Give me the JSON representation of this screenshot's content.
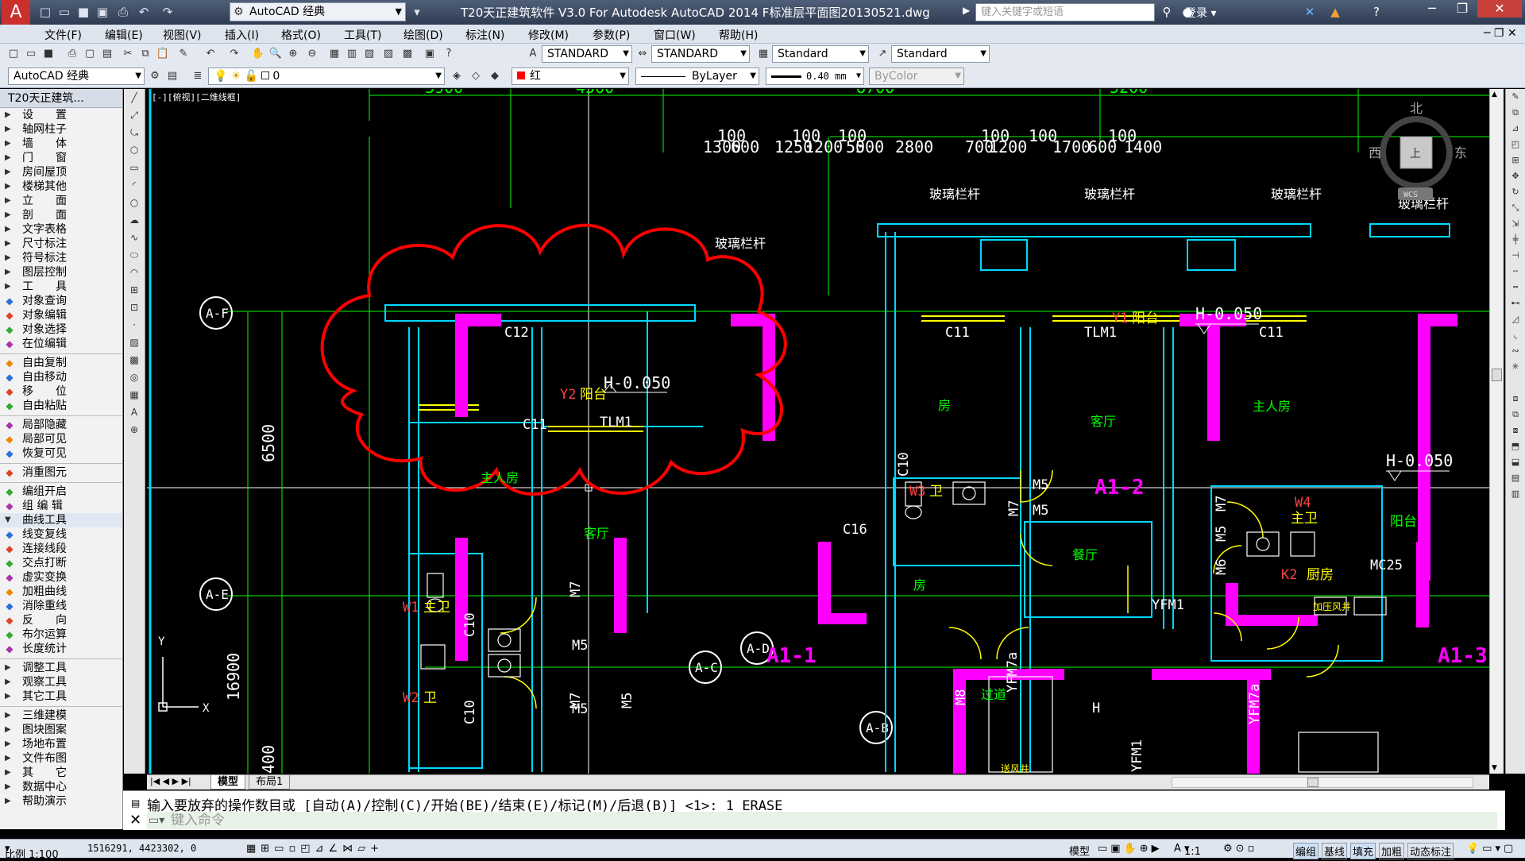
{
  "app": {
    "workspace": "AutoCAD 经典",
    "title": "T20天正建筑软件 V3.0 For Autodesk AutoCAD 2014    F标准层平面图20130521.dwg",
    "search_placeholder": "键入关键字或短语",
    "login": "登录"
  },
  "menu": [
    "文件(F)",
    "编辑(E)",
    "视图(V)",
    "插入(I)",
    "格式(O)",
    "工具(T)",
    "绘图(D)",
    "标注(N)",
    "修改(M)",
    "参数(P)",
    "窗口(W)",
    "帮助(H)"
  ],
  "toolbar": {
    "text_style": "STANDARD",
    "dim_style": "STANDARD",
    "table_style": "Standard",
    "mleader_style": "Standard",
    "workspace2": "AutoCAD 经典",
    "layer": "0",
    "color": "红",
    "linetype": "ByLayer",
    "lineweight": "0.40 mm",
    "plotstyle": "ByColor"
  },
  "left_panel": {
    "title": "T20天正建筑...",
    "items": [
      "设　　置",
      "轴网柱子",
      "墙　　体",
      "门　　窗",
      "房间屋顶",
      "楼梯其他",
      "立　　面",
      "剖　　面",
      "文字表格",
      "尺寸标注",
      "符号标注",
      "图层控制",
      "工　　具"
    ],
    "tools": [
      "对象查询",
      "对象编辑",
      "对象选择",
      "在位编辑",
      "自由复制",
      "自由移动",
      "移　　位",
      "自由粘贴",
      "局部隐藏",
      "局部可见",
      "恢复可见",
      "消重图元",
      "编组开启",
      "组 编 辑"
    ],
    "curve_header": "曲线工具",
    "curve_items": [
      "线变复线",
      "连接线段",
      "交点打断",
      "虚实变换",
      "加粗曲线",
      "消除重线",
      "反　　向",
      "布尔运算",
      "长度统计"
    ],
    "bottom_items": [
      "调整工具",
      "观察工具",
      "其它工具",
      "三维建模",
      "图块图案",
      "场地布置",
      "文件布图",
      "其　　它",
      "数据中心",
      "帮助演示"
    ]
  },
  "canvas": {
    "viewport_label": "[-][俯视][二维线框]",
    "dims_top": [
      "3900",
      "4500",
      "8700",
      "5200"
    ],
    "dims_second": [
      "1300",
      "100",
      "600",
      "1250",
      "100",
      "1200",
      "100",
      "50",
      "500",
      "2800",
      "700",
      "100",
      "1200",
      "100",
      "1700",
      "600",
      "100",
      "1400"
    ],
    "railing": "玻璃栏杆",
    "elev1": "H-0.050",
    "axis_labels": [
      "A-F",
      "A-E",
      "A-D",
      "A-C",
      "A-B"
    ],
    "windows": [
      "C12",
      "C11",
      "C11",
      "C11",
      "C10",
      "C16",
      "C10",
      "C10",
      "MC25"
    ],
    "doors": [
      "M5",
      "M5",
      "M7",
      "M5",
      "M7",
      "M8",
      "M5",
      "M6",
      "M7",
      "M5",
      "YFM1",
      "YFM7a",
      "YFM7a",
      "YFM1"
    ],
    "rooms": [
      "房",
      "客厅",
      "主人房",
      "主人房",
      "客厅",
      "房",
      "餐厅",
      "厨房",
      "过道",
      "阳台",
      "卫",
      "主卫"
    ],
    "tags_red": [
      "Y1",
      "Y2",
      "W3",
      "W4",
      "W1",
      "W2",
      "K2"
    ],
    "tag_texts": [
      "阳台",
      "阳台",
      "卫",
      "主卫",
      "主卫",
      "卫",
      "厨房"
    ],
    "units": [
      "A1-1",
      "A1-2",
      "A1-3"
    ],
    "dim_left": [
      "6500",
      "16900",
      "400"
    ],
    "tlm": "TLM1",
    "compass": {
      "n": "北",
      "e": "东",
      "w": "西",
      "center": "上",
      "wcs": "WCS"
    },
    "misc": [
      "H",
      "加压风井",
      "送风井"
    ]
  },
  "tabs": [
    "模型",
    "布局1"
  ],
  "command": {
    "history": "输入要放弃的操作数目或 [自动(A)/控制(C)/开始(BE)/结束(E)/标记(M)/后退(B)] <1>: 1 ERASE",
    "placeholder": "键入命令"
  },
  "status": {
    "scale": "比例 1:100",
    "coords": "1516291, 4423302, 0",
    "model": "模型",
    "annot_scale": "1:1",
    "buttons": [
      "编组",
      "基线",
      "填充",
      "加粗",
      "动态标注"
    ]
  },
  "colors": {
    "wall": "#ff00ff",
    "axis": "#00ff00",
    "dim": "#00ff00",
    "revcloud": "#ff0000",
    "cyan": "#00d7ff",
    "yellow": "#ffff00"
  }
}
